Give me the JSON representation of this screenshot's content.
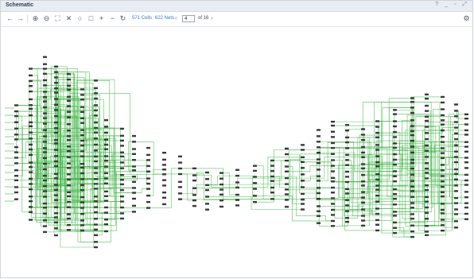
{
  "window": {
    "title": "Schematic",
    "controls": "? _ ▫ ⤢"
  },
  "toolbar": {
    "back_icon": "arrow-left-icon",
    "forward_icon": "arrow-right-icon",
    "zoom_in_icon": "zoom-in-icon",
    "zoom_out_icon": "zoom-out-icon",
    "fit_icon": "fit-view-icon",
    "fit_selection_icon": "fit-selection-icon",
    "refresh_icon": "refresh-icon",
    "cells_label": "571 Cells",
    "nets_label": "622 Nets",
    "page_value": "4",
    "page_of": "of 16",
    "settings_icon": "gear-icon"
  },
  "colors": {
    "wire": "#43b64a",
    "cell": "#3a3a3a",
    "header": "#e7edf3"
  }
}
